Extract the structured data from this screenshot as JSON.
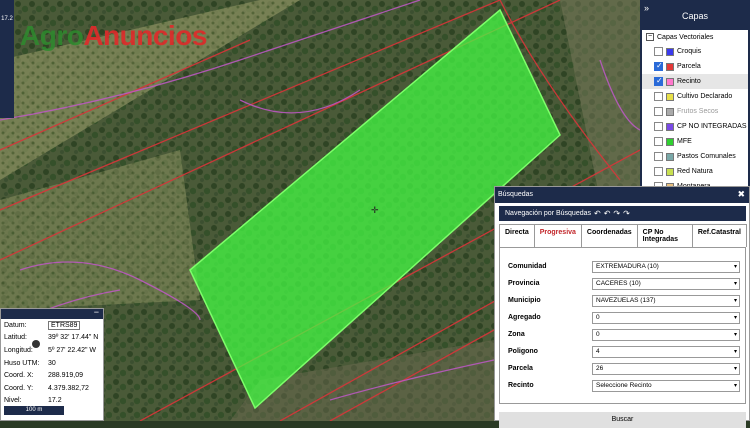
{
  "app": {
    "logo_part1": "Agro",
    "logo_part2": "Anuncios",
    "side_value": "17.2"
  },
  "layers": {
    "title": "Capas",
    "group_label": "Capas Vectoriales",
    "items": [
      {
        "label": "Croquis",
        "checked": false,
        "color": "#3a3aee"
      },
      {
        "label": "Parcela",
        "checked": true,
        "color": "#e53a3a"
      },
      {
        "label": "Recinto",
        "checked": true,
        "color": "#ff77cc",
        "selected": true
      },
      {
        "label": "Cultivo Declarado",
        "checked": false,
        "color": "#e8e04a"
      },
      {
        "label": "Frutos Secos",
        "checked": false,
        "color": "#aaaaaa",
        "disabled": true
      },
      {
        "label": "CP NO INTEGRADAS",
        "checked": false,
        "color": "#7a4ae6"
      },
      {
        "label": "MFE",
        "checked": false,
        "color": "#2fd02f"
      },
      {
        "label": "Pastos Comunales",
        "checked": false,
        "color": "#7aa8a8"
      },
      {
        "label": "Red Natura",
        "checked": false,
        "color": "#c8e050"
      },
      {
        "label": "Montanera",
        "checked": false,
        "color": "#e8c080"
      }
    ]
  },
  "search": {
    "title": "Búsquedas",
    "nav_label": "Navegación por Búsquedas",
    "tabs": [
      "Directa",
      "Progresiva",
      "Coordenadas",
      "CP No Integradas",
      "Ref.Catastral"
    ],
    "active_tab": "Progresiva",
    "fields": [
      {
        "label": "Comunidad",
        "value": "EXTREMADURA (10)"
      },
      {
        "label": "Provincia",
        "value": "CACERES (10)"
      },
      {
        "label": "Municipio",
        "value": "NAVEZUELAS (137)"
      },
      {
        "label": "Agregado",
        "value": "0"
      },
      {
        "label": "Zona",
        "value": "0"
      },
      {
        "label": "Poligono",
        "value": "4"
      },
      {
        "label": "Parcela",
        "value": "26"
      },
      {
        "label": "Recinto",
        "value": "Seleccione Recinto"
      }
    ],
    "button_label": "Buscar"
  },
  "coords": {
    "rows": [
      {
        "label": "Datum:",
        "value": "ETRS89"
      },
      {
        "label": "Latitud:",
        "value": "39º 32' 17.44\" N"
      },
      {
        "label": "Longitud:",
        "value": "5º 27' 22.42\" W"
      },
      {
        "label": "Huso UTM:",
        "value": "30"
      },
      {
        "label": "Coord. X:",
        "value": "288.919,09"
      },
      {
        "label": "Coord. Y:",
        "value": "4.379.382,72"
      },
      {
        "label": "Nivel:",
        "value": "17.2"
      }
    ],
    "scale_label": "100 m"
  },
  "colors": {
    "panel_dark": "#1d2b4a",
    "parcel_fill": "#44ff44",
    "active_tab": "#c2262a"
  }
}
